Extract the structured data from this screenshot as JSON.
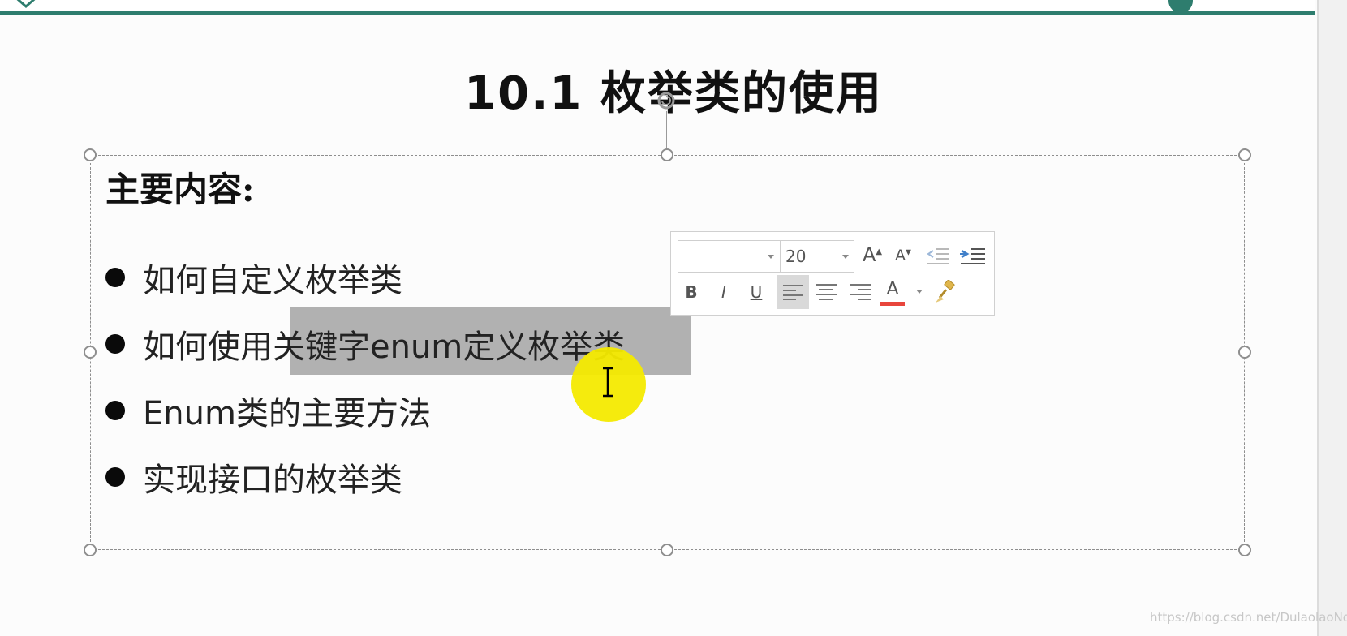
{
  "slide": {
    "title": "10.1 枚举类的使用",
    "heading": "主要内容:",
    "bullets": [
      "如何自定义枚举类",
      "如何使用关键字enum定义枚举类",
      "Enum类的主要方法",
      "实现接口的枚举类"
    ],
    "selected_text": "关键字enum定义枚举类"
  },
  "mini_toolbar": {
    "font_name": "",
    "font_size": "20",
    "buttons": {
      "grow_font": "A",
      "shrink_font": "A",
      "bold": "B",
      "italic": "I",
      "underline": "U",
      "font_color": "A"
    },
    "colors": {
      "font_color_bar": "#e8453c",
      "indent_icon": "#3f7fc9"
    }
  },
  "watermark": "https://blog.csdn.net/DulaolaoNo",
  "colors": {
    "accent": "#2e7d6e",
    "highlight": "#a3a3a3",
    "cursor_spot": "#f4ea00"
  }
}
